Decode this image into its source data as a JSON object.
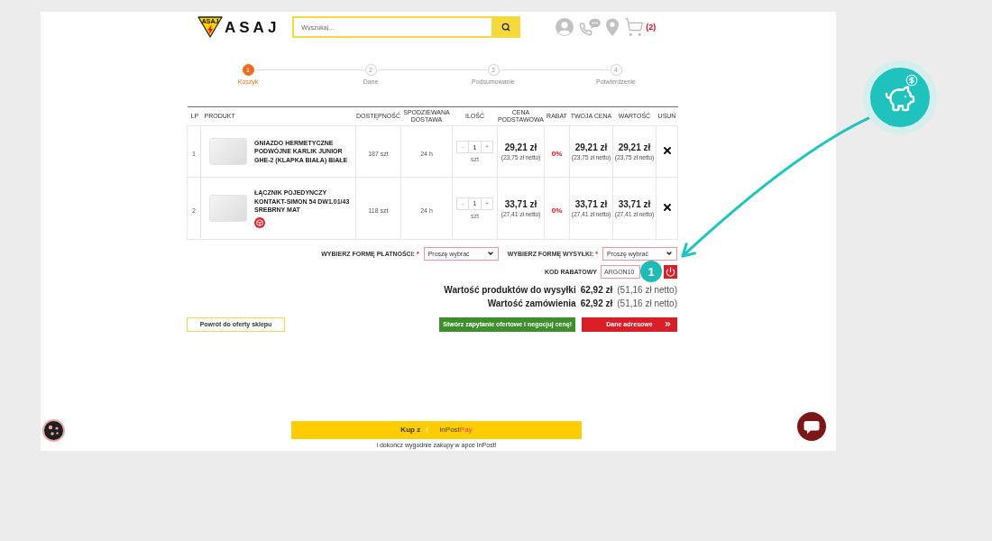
{
  "header": {
    "logo_mark": "ASAJ",
    "logo": "ASAJ",
    "search": {
      "placeholder": "Wyszukaj..."
    },
    "cart_count": "(2)"
  },
  "steps": [
    {
      "number": "1",
      "label": "Koszyk",
      "selected": true
    },
    {
      "number": "2",
      "label": "Dane",
      "selected": false
    },
    {
      "number": "3",
      "label": "Podsumowanie",
      "selected": false
    },
    {
      "number": "4",
      "label": "Potwierdzenie",
      "selected": false
    }
  ],
  "table": {
    "columns": [
      "LP",
      "PRODUKT",
      "DOSTĘPNOŚĆ",
      "SPODZIEWANA DOSTAWA",
      "ILOŚĆ",
      "CENA PODSTAWOWA",
      "RABAT",
      "TWOJA CENA",
      "WARTOŚĆ",
      "USUŃ"
    ],
    "rows": [
      {
        "lp": "1",
        "name": "GNIAZDO HERMETYCZNE PODWÓJNE KARLIK JUNIOR GHE-2 (KLAPKA BIAŁA) BIAŁE",
        "badge_icon": false,
        "availability": "187 szt",
        "delivery": "24 h",
        "quantity": {
          "minus": "-",
          "value": "1",
          "plus": "+",
          "unit": "szt"
        },
        "base_price": {
          "gross": "29,21 zł",
          "net": "(23,75 zł netto)"
        },
        "discount": "0%",
        "your_price": {
          "gross": "29,21 zł",
          "net": "(23,75 zł netto)"
        },
        "value": {
          "gross": "29,21 zł",
          "net": "(23,75 zł netto)"
        }
      },
      {
        "lp": "2",
        "name": "ŁĄCZNIK POJEDYNCZY KONTAKT-SIMON 54 DW1.01/43 SREBRNY MAT",
        "badge_icon": true,
        "availability": "118 szt",
        "delivery": "24 h",
        "quantity": {
          "minus": "-",
          "value": "1",
          "plus": "+",
          "unit": "szt"
        },
        "base_price": {
          "gross": "33,71 zł",
          "net": "(27,41 zł netto)"
        },
        "discount": "0%",
        "your_price": {
          "gross": "33,71 zł",
          "net": "(27,41 zł netto)"
        },
        "value": {
          "gross": "33,71 zł",
          "net": "(27,41 zł netto)"
        }
      }
    ]
  },
  "checkout": {
    "payment": {
      "label": "WYBIERZ FORMĘ PŁATNOŚCI:",
      "required_mark": "*",
      "value": "Proszę wybrać",
      "error": true
    },
    "shipping": {
      "label": "WYBIERZ FORMĘ WYSYŁKI:",
      "required_mark": "*",
      "value": "Proszę wybrać",
      "error": true
    },
    "coupon": {
      "label": "KOD RABATOWY",
      "value": "ARGON10",
      "error": true
    },
    "totals": [
      {
        "label": "Wartość produktów do wysyłki",
        "amount": "62,92 zł",
        "net": "(51,16 zł netto)"
      },
      {
        "label": "Wartość zamówienia",
        "amount": "62,92 zł",
        "net": "(51,16 zł netto)"
      }
    ]
  },
  "actions": {
    "back": "Powrót do oferty sklepu",
    "inquiry": "Stwórz zapytanie ofertowe i negocjuj cenę!",
    "next": "Dane adresowe"
  },
  "inpost": {
    "prefix": "Kup z",
    "brand": "InPost",
    "brand_accent": "Pay",
    "note": "i dokończ wygodnie zakupy w apce InPost!"
  },
  "annotation": {
    "badge": "1"
  }
}
